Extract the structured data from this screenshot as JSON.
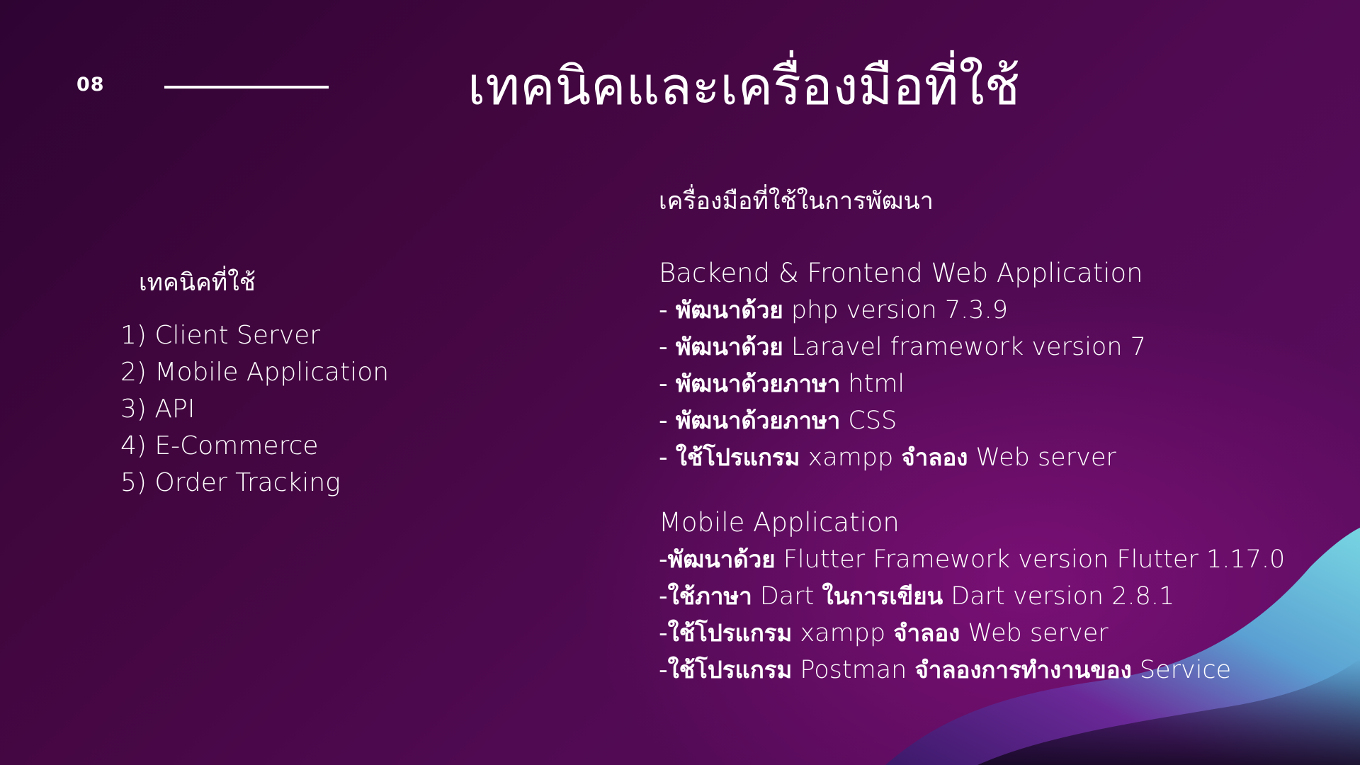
{
  "slide_number": "08",
  "title": "เทคนิคและเครื่องมือที่ใช้",
  "techniques": {
    "heading": "เทคนิคที่ใช้",
    "items": [
      "1) Client  Server",
      "2) Mobile  Application",
      "3) API",
      "4) E-Commerce",
      "5) Order Tracking"
    ]
  },
  "tools": {
    "heading": "เครื่องมือที่ใช้ในการพัฒนา",
    "web": {
      "title": "Backend & Frontend Web Application",
      "items": [
        {
          "prefix": "- ",
          "th": "พัฒนาด้วย",
          "en": " php  version 7.3.9"
        },
        {
          "prefix": "- ",
          "th": "พัฒนาด้วย",
          "en": " Laravel framework version 7"
        },
        {
          "prefix": "- ",
          "th": "พัฒนาด้วยภาษา",
          "en": " html"
        },
        {
          "prefix": "- ",
          "th": "พัฒนาด้วยภาษา",
          "en": " CSS"
        },
        {
          "prefix": "- ",
          "th": "ใช้โปรแกรม",
          "en": "  xampp ",
          "th2": "จำลอง",
          "en2": " Web server"
        }
      ]
    },
    "mobile": {
      "title": "Mobile Application",
      "items": [
        {
          "prefix": "-",
          "th": "พัฒนาด้วย",
          "en": " Flutter Framework version Flutter 1.17.0"
        },
        {
          "prefix": "-",
          "th": "ใช้ภาษา",
          "en": " Dart ",
          "th2": "ในการเขียน",
          "en2": " Dart version 2.8.1"
        },
        {
          "prefix": "-",
          "th": "ใช้โปรแกรม",
          "en": " xampp ",
          "th2": "จำลอง",
          "en2": " Web server"
        },
        {
          "prefix": "-",
          "th": "ใช้โปรแกรม",
          "en": " Postman ",
          "th2": "จำลองการทำงานของ",
          "en2": " Service"
        }
      ]
    }
  },
  "colors": {
    "background_dark": "#2e0433",
    "background_purple": "#5e0d63",
    "wave_cyan": "#6fd6e0",
    "wave_violet": "#7a2a9a",
    "text": "#ffffff"
  }
}
